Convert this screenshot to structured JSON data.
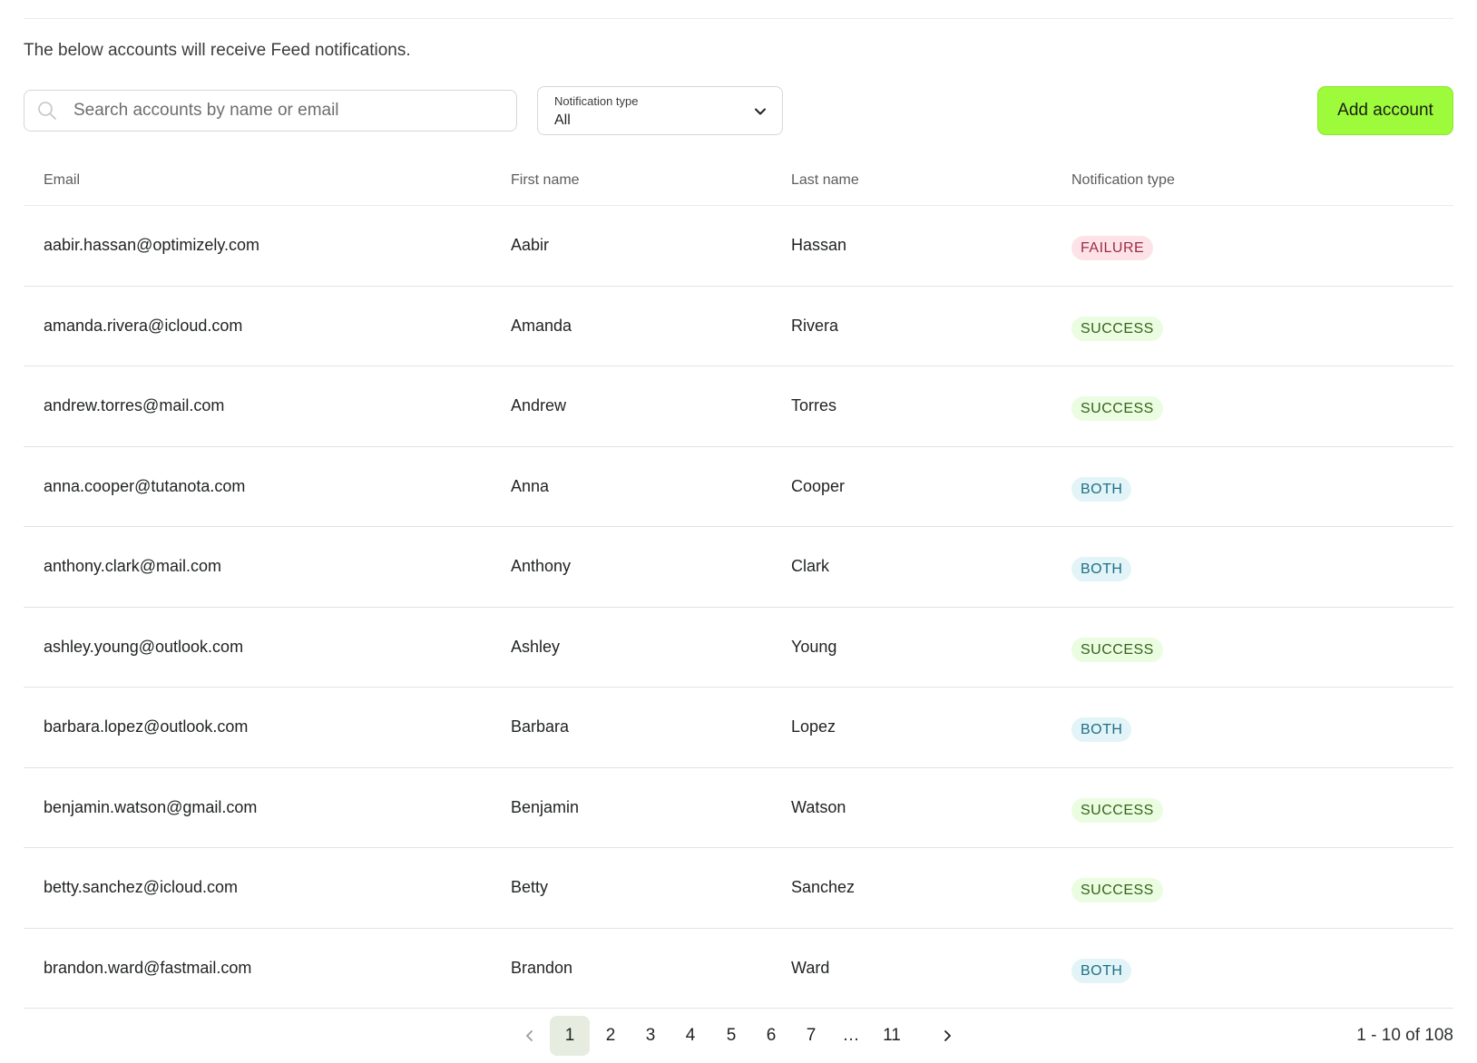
{
  "intro_text": "The below accounts will receive Feed notifications.",
  "search": {
    "placeholder": "Search accounts by name or email",
    "value": ""
  },
  "filter": {
    "label": "Notification type",
    "value": "All"
  },
  "add_button_label": "Add account",
  "columns": {
    "email": "Email",
    "first": "First name",
    "last": "Last name",
    "type": "Notification type"
  },
  "rows": [
    {
      "email": "aabir.hassan@optimizely.com",
      "first": "Aabir",
      "last": "Hassan",
      "type": "FAILURE"
    },
    {
      "email": "amanda.rivera@icloud.com",
      "first": "Amanda",
      "last": "Rivera",
      "type": "SUCCESS"
    },
    {
      "email": "andrew.torres@mail.com",
      "first": "Andrew",
      "last": "Torres",
      "type": "SUCCESS"
    },
    {
      "email": "anna.cooper@tutanota.com",
      "first": "Anna",
      "last": "Cooper",
      "type": "BOTH"
    },
    {
      "email": "anthony.clark@mail.com",
      "first": "Anthony",
      "last": "Clark",
      "type": "BOTH"
    },
    {
      "email": "ashley.young@outlook.com",
      "first": "Ashley",
      "last": "Young",
      "type": "SUCCESS"
    },
    {
      "email": "barbara.lopez@outlook.com",
      "first": "Barbara",
      "last": "Lopez",
      "type": "BOTH"
    },
    {
      "email": "benjamin.watson@gmail.com",
      "first": "Benjamin",
      "last": "Watson",
      "type": "SUCCESS"
    },
    {
      "email": "betty.sanchez@icloud.com",
      "first": "Betty",
      "last": "Sanchez",
      "type": "SUCCESS"
    },
    {
      "email": "brandon.ward@fastmail.com",
      "first": "Brandon",
      "last": "Ward",
      "type": "BOTH"
    }
  ],
  "pagination": {
    "pages": [
      "1",
      "2",
      "3",
      "4",
      "5",
      "6",
      "7",
      "…",
      "11"
    ],
    "current": "1",
    "range": "1 - 10 of 108"
  },
  "badge_colors": {
    "FAILURE": {
      "bg": "#fde3e7",
      "fg": "#9b2c45"
    },
    "SUCCESS": {
      "bg": "#eafde0",
      "fg": "#37621a"
    },
    "BOTH": {
      "bg": "#e2f4f7",
      "fg": "#1f6f86"
    }
  },
  "accent_color": "#9dfb3c",
  "icons": {
    "search": "search-icon",
    "dropdown": "chevron-down-icon",
    "prev": "chevron-left-icon",
    "next": "chevron-right-icon"
  }
}
